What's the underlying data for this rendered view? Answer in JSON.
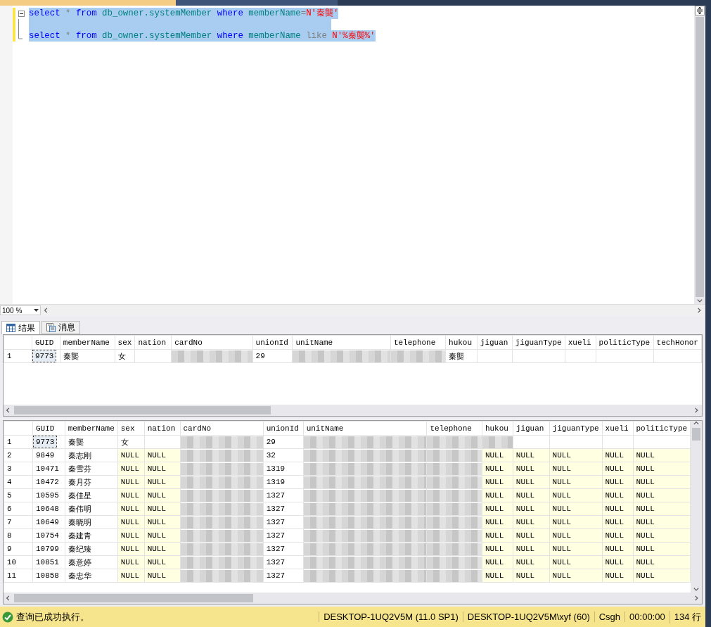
{
  "document_tabs": [
    {
      "selected": true
    },
    {
      "selected": false
    }
  ],
  "editor": {
    "lines": [
      {
        "selected": true,
        "tokens": [
          {
            "kind": "keyword",
            "text": "select"
          },
          {
            "kind": "operator",
            "text": " * "
          },
          {
            "kind": "keyword",
            "text": "from"
          },
          {
            "kind": "ident",
            "text": " db_owner.systemMember "
          },
          {
            "kind": "keyword",
            "text": "where"
          },
          {
            "kind": "ident",
            "text": " memberName"
          },
          {
            "kind": "operator",
            "text": "="
          },
          {
            "kind": "string",
            "text": "N'秦龑'"
          }
        ]
      },
      {
        "selected": true
      },
      {
        "selected": true,
        "tokens": [
          {
            "kind": "keyword",
            "text": "select"
          },
          {
            "kind": "operator",
            "text": " * "
          },
          {
            "kind": "keyword",
            "text": "from"
          },
          {
            "kind": "ident",
            "text": " db_owner.systemMember "
          },
          {
            "kind": "keyword",
            "text": "where"
          },
          {
            "kind": "ident",
            "text": " memberName "
          },
          {
            "kind": "operator",
            "text": "like"
          },
          {
            "kind": "string",
            "text": " N'%秦龑%'"
          }
        ]
      }
    ]
  },
  "zoom": {
    "value": "100 %"
  },
  "result_tabs": [
    {
      "label": "结果",
      "selected": true
    },
    {
      "label": "消息",
      "selected": false
    }
  ],
  "grids": [
    {
      "columns": [
        "GUID",
        "memberName",
        "sex",
        "nation",
        "cardNo",
        "unionId",
        "unitName",
        "telephone",
        "hukou",
        "jiguan",
        "jiguanType",
        "xueli",
        "politicType",
        "techHonor"
      ],
      "rows": [
        {
          "number": "1",
          "cells": [
            {
              "kind": "focus",
              "text": "9773"
            },
            "秦龑",
            "女",
            {
              "kind": "empty"
            },
            {
              "kind": "blurred"
            },
            "29",
            {
              "kind": "blurred"
            },
            {
              "kind": "blurred"
            },
            "秦龑",
            {
              "kind": "empty"
            },
            {
              "kind": "empty"
            },
            {
              "kind": "empty"
            },
            {
              "kind": "empty"
            },
            {
              "kind": "empty"
            }
          ]
        }
      ]
    },
    {
      "columns": [
        "GUID",
        "memberName",
        "sex",
        "nation",
        "cardNo",
        "unionId",
        "unitName",
        "telephone",
        "hukou",
        "jiguan",
        "jiguanType",
        "xueli",
        "politicType"
      ],
      "rows": [
        {
          "number": "1",
          "cells": [
            {
              "kind": "focus",
              "text": "9773"
            },
            "秦龑",
            "女",
            {
              "kind": "empty"
            },
            {
              "kind": "blurred"
            },
            "29",
            {
              "kind": "blurred"
            },
            {
              "kind": "blurred"
            },
            {
              "kind": "blurred"
            },
            {
              "kind": "empty"
            },
            {
              "kind": "empty"
            },
            {
              "kind": "empty"
            },
            {
              "kind": "empty"
            }
          ]
        },
        {
          "number": "2",
          "cells": [
            "9849",
            "秦志刚",
            {
              "kind": "null",
              "text": "NULL"
            },
            {
              "kind": "null",
              "text": "NULL"
            },
            {
              "kind": "blurred"
            },
            "32",
            {
              "kind": "blurred"
            },
            {
              "kind": "blurred"
            },
            {
              "kind": "null",
              "text": "NULL"
            },
            {
              "kind": "null",
              "text": "NULL"
            },
            {
              "kind": "null",
              "text": "NULL"
            },
            {
              "kind": "null",
              "text": "NULL"
            },
            {
              "kind": "null",
              "text": "NULL"
            }
          ]
        },
        {
          "number": "3",
          "cells": [
            "10471",
            "秦雪芬",
            {
              "kind": "null",
              "text": "NULL"
            },
            {
              "kind": "null",
              "text": "NULL"
            },
            {
              "kind": "blurred"
            },
            "1319",
            {
              "kind": "blurred"
            },
            {
              "kind": "blurred"
            },
            {
              "kind": "null",
              "text": "NULL"
            },
            {
              "kind": "null",
              "text": "NULL"
            },
            {
              "kind": "null",
              "text": "NULL"
            },
            {
              "kind": "null",
              "text": "NULL"
            },
            {
              "kind": "null",
              "text": "NULL"
            }
          ]
        },
        {
          "number": "4",
          "cells": [
            "10472",
            "秦月芬",
            {
              "kind": "null",
              "text": "NULL"
            },
            {
              "kind": "null",
              "text": "NULL"
            },
            {
              "kind": "blurred"
            },
            "1319",
            {
              "kind": "blurred"
            },
            {
              "kind": "blurred"
            },
            {
              "kind": "null",
              "text": "NULL"
            },
            {
              "kind": "null",
              "text": "NULL"
            },
            {
              "kind": "null",
              "text": "NULL"
            },
            {
              "kind": "null",
              "text": "NULL"
            },
            {
              "kind": "null",
              "text": "NULL"
            }
          ]
        },
        {
          "number": "5",
          "cells": [
            "10595",
            "秦佳星",
            {
              "kind": "null",
              "text": "NULL"
            },
            {
              "kind": "null",
              "text": "NULL"
            },
            {
              "kind": "blurred"
            },
            "1327",
            {
              "kind": "blurred"
            },
            {
              "kind": "blurred"
            },
            {
              "kind": "null",
              "text": "NULL"
            },
            {
              "kind": "null",
              "text": "NULL"
            },
            {
              "kind": "null",
              "text": "NULL"
            },
            {
              "kind": "null",
              "text": "NULL"
            },
            {
              "kind": "null",
              "text": "NULL"
            }
          ]
        },
        {
          "number": "6",
          "cells": [
            "10648",
            "秦伟明",
            {
              "kind": "null",
              "text": "NULL"
            },
            {
              "kind": "null",
              "text": "NULL"
            },
            {
              "kind": "blurred"
            },
            "1327",
            {
              "kind": "blurred"
            },
            {
              "kind": "blurred"
            },
            {
              "kind": "null",
              "text": "NULL"
            },
            {
              "kind": "null",
              "text": "NULL"
            },
            {
              "kind": "null",
              "text": "NULL"
            },
            {
              "kind": "null",
              "text": "NULL"
            },
            {
              "kind": "null",
              "text": "NULL"
            }
          ]
        },
        {
          "number": "7",
          "cells": [
            "10649",
            "秦晓明",
            {
              "kind": "null",
              "text": "NULL"
            },
            {
              "kind": "null",
              "text": "NULL"
            },
            {
              "kind": "blurred"
            },
            "1327",
            {
              "kind": "blurred"
            },
            {
              "kind": "blurred"
            },
            {
              "kind": "null",
              "text": "NULL"
            },
            {
              "kind": "null",
              "text": "NULL"
            },
            {
              "kind": "null",
              "text": "NULL"
            },
            {
              "kind": "null",
              "text": "NULL"
            },
            {
              "kind": "null",
              "text": "NULL"
            }
          ]
        },
        {
          "number": "8",
          "cells": [
            "10754",
            "秦建青",
            {
              "kind": "null",
              "text": "NULL"
            },
            {
              "kind": "null",
              "text": "NULL"
            },
            {
              "kind": "blurred"
            },
            "1327",
            {
              "kind": "blurred"
            },
            {
              "kind": "blurred"
            },
            {
              "kind": "null",
              "text": "NULL"
            },
            {
              "kind": "null",
              "text": "NULL"
            },
            {
              "kind": "null",
              "text": "NULL"
            },
            {
              "kind": "null",
              "text": "NULL"
            },
            {
              "kind": "null",
              "text": "NULL"
            }
          ]
        },
        {
          "number": "9",
          "cells": [
            "10799",
            "秦纪臻",
            {
              "kind": "null",
              "text": "NULL"
            },
            {
              "kind": "null",
              "text": "NULL"
            },
            {
              "kind": "blurred"
            },
            "1327",
            {
              "kind": "blurred"
            },
            {
              "kind": "blurred"
            },
            {
              "kind": "null",
              "text": "NULL"
            },
            {
              "kind": "null",
              "text": "NULL"
            },
            {
              "kind": "null",
              "text": "NULL"
            },
            {
              "kind": "null",
              "text": "NULL"
            },
            {
              "kind": "null",
              "text": "NULL"
            }
          ]
        },
        {
          "number": "10",
          "cells": [
            "10851",
            "秦意婷",
            {
              "kind": "null",
              "text": "NULL"
            },
            {
              "kind": "null",
              "text": "NULL"
            },
            {
              "kind": "blurred"
            },
            "1327",
            {
              "kind": "blurred"
            },
            {
              "kind": "blurred"
            },
            {
              "kind": "null",
              "text": "NULL"
            },
            {
              "kind": "null",
              "text": "NULL"
            },
            {
              "kind": "null",
              "text": "NULL"
            },
            {
              "kind": "null",
              "text": "NULL"
            },
            {
              "kind": "null",
              "text": "NULL"
            }
          ]
        },
        {
          "number": "11",
          "cells": [
            "10858",
            "秦忠华",
            {
              "kind": "null",
              "text": "NULL"
            },
            {
              "kind": "null",
              "text": "NULL"
            },
            {
              "kind": "blurred"
            },
            "1327",
            {
              "kind": "blurred"
            },
            {
              "kind": "blurred"
            },
            {
              "kind": "null",
              "text": "NULL"
            },
            {
              "kind": "null",
              "text": "NULL"
            },
            {
              "kind": "null",
              "text": "NULL"
            },
            {
              "kind": "null",
              "text": "NULL"
            },
            {
              "kind": "null",
              "text": "NULL"
            }
          ]
        }
      ]
    }
  ],
  "status_bar": {
    "message": "查询已成功执行。",
    "items": [
      "DESKTOP-1UQ2V5M (11.0 SP1)",
      "DESKTOP-1UQ2V5M\\xyf (60)",
      "Csgh",
      "00:00:00",
      "134 行"
    ]
  }
}
